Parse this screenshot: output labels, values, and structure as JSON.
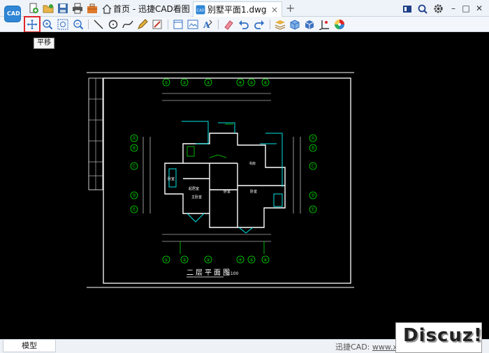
{
  "tabs": {
    "home": "首页 - 迅捷CAD看图",
    "file": "别墅平面1.dwg",
    "close": "×",
    "add": "+"
  },
  "logo": {
    "text": "CAD"
  },
  "tooltip": {
    "text": "平移"
  },
  "drawing": {
    "title": "二层平面图",
    "scale": "1:100",
    "rooms": [
      "卧室",
      "起居室",
      "主卧室",
      "卧室",
      "书房",
      "卧室"
    ],
    "grid_top": [
      "①",
      "②",
      "③",
      "④",
      "⑤",
      "⑥"
    ],
    "grid_bottom": [
      "①",
      "②",
      "③",
      "④",
      "⑤",
      "⑥"
    ],
    "grid_left": [
      "Ⓐ",
      "Ⓑ",
      "Ⓒ",
      "Ⓓ",
      "Ⓔ"
    ],
    "grid_right": [
      "Ⓐ",
      "Ⓑ",
      "Ⓒ",
      "Ⓓ",
      "Ⓔ"
    ]
  },
  "status": {
    "model_tab": "模型",
    "site_label": "迅捷CAD:",
    "site_link": "www.xu"
  },
  "watermark": {
    "text": "Discuz!"
  },
  "colors": {
    "accent": "#2f86d6",
    "active_outline": "#e0282d",
    "drawing_white": "#ffffff",
    "drawing_cyan": "#00e5e5",
    "drawing_green": "#00e000"
  }
}
